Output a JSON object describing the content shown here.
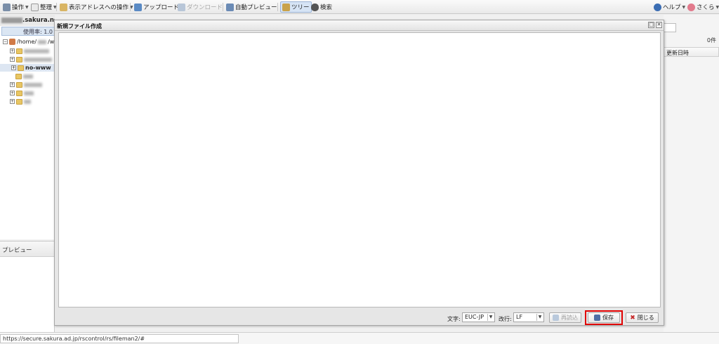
{
  "toolbar": {
    "items": [
      {
        "label": "操作",
        "icon": "operation-icon",
        "dropdown": true
      },
      {
        "label": "整理",
        "icon": "organize-icon",
        "dropdown": true
      },
      {
        "label": "表示アドレスへの操作",
        "icon": "address-icon",
        "dropdown": true
      },
      {
        "label": "アップロード",
        "icon": "upload-icon"
      },
      {
        "label": "ダウンロード",
        "icon": "download-icon",
        "disabled": true
      },
      {
        "label": "自動プレビュー",
        "icon": "auto-preview-icon"
      },
      {
        "label": "ツリー",
        "icon": "tree-icon",
        "active": true
      },
      {
        "label": "検索",
        "icon": "search-icon"
      }
    ],
    "help_label": "ヘルプ",
    "user_label": "さくら"
  },
  "left": {
    "domain_suffix": ".sakura.ne.jp",
    "usage_label": "使用率: 1.0",
    "root_path": "/home/",
    "root_suffix": "/ww",
    "selected_folder": "no-www"
  },
  "preview": {
    "title": "プレビュー"
  },
  "right": {
    "count": "0件",
    "column_header": "更新日時"
  },
  "dialog": {
    "title": "新規ファイル作成",
    "editor_value": "",
    "charset_label": "文字:",
    "charset_value": "EUC-JP",
    "newline_label": "改行:",
    "newline_value": "LF",
    "reload_button": "再読込",
    "save_button": "保存",
    "close_button": "閉じる"
  },
  "status": {
    "url": "https://secure.sakura.ad.jp/rscontrol/rs/fileman2/#"
  },
  "colors": {
    "highlight": "#e00000",
    "accent": "#dbe6f3"
  }
}
